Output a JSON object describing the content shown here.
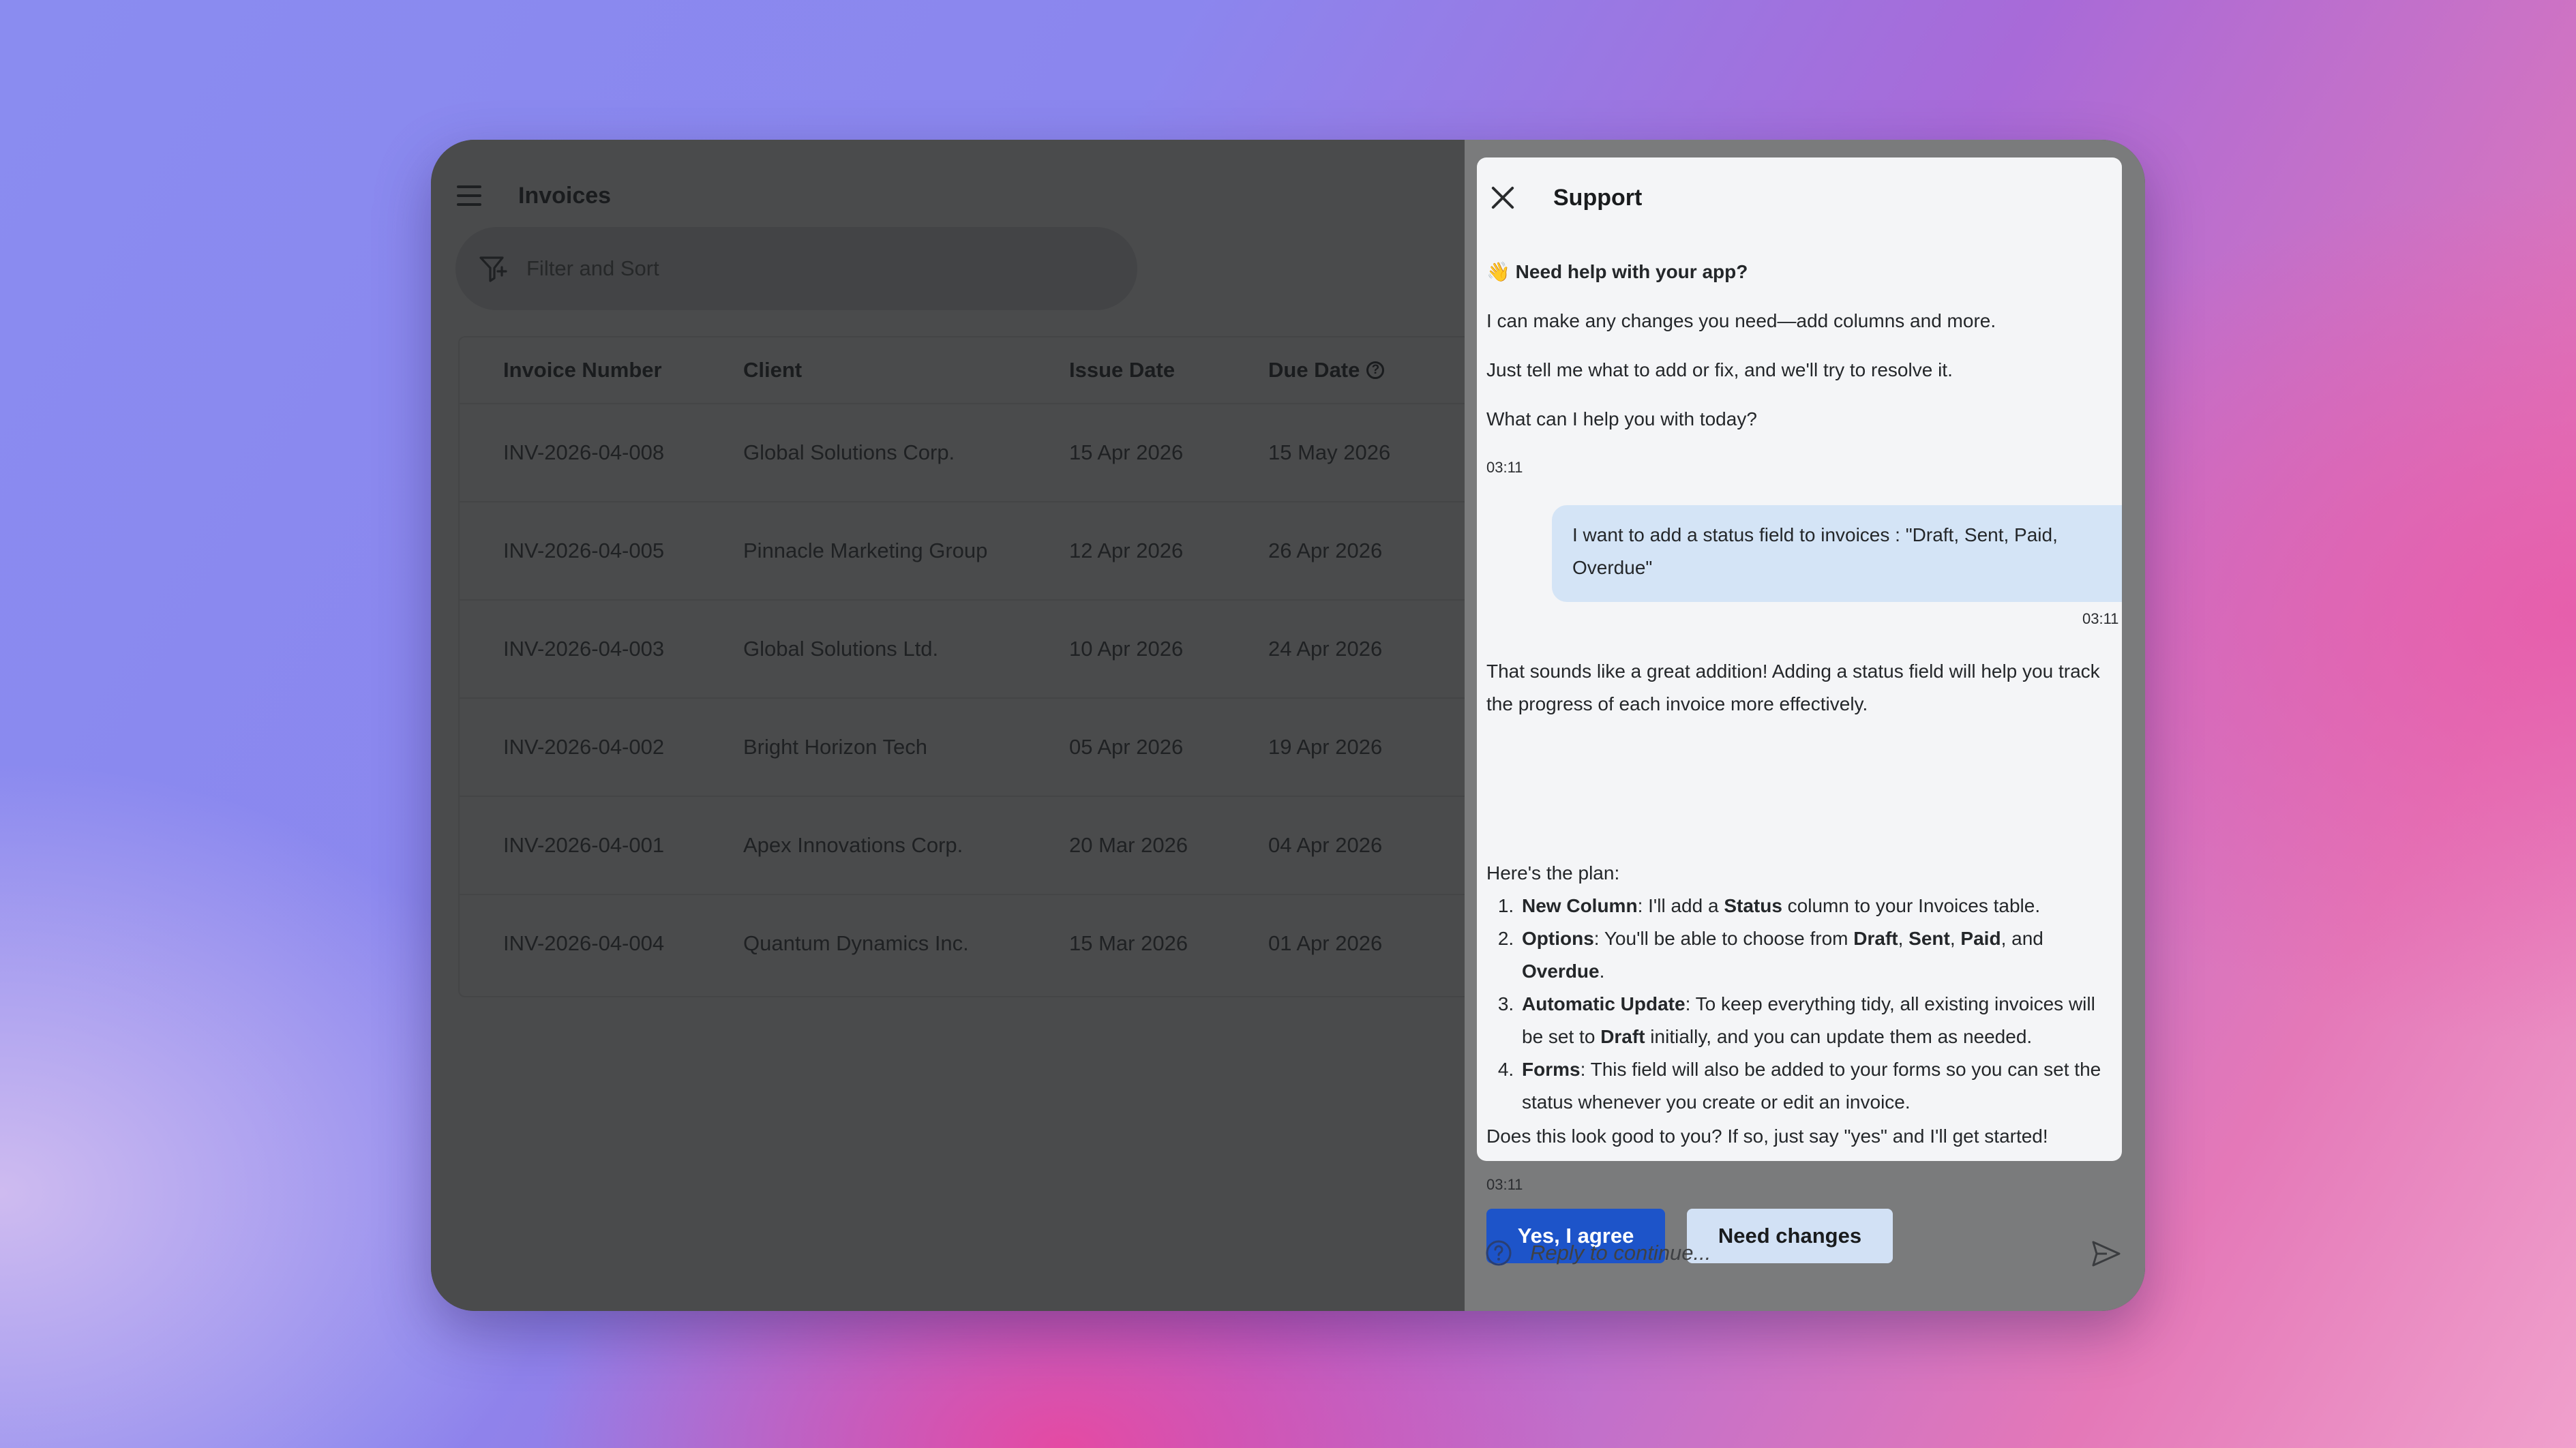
{
  "app": {
    "title": "Invoices",
    "filter_placeholder": "Filter and Sort",
    "columns": [
      "Invoice Number",
      "Client",
      "Issue Date",
      "Due Date"
    ],
    "rows": [
      [
        "INV-2026-04-008",
        "Global Solutions Corp.",
        "15 Apr 2026",
        "15 May 2026"
      ],
      [
        "INV-2026-04-005",
        "Pinnacle Marketing Group",
        "12 Apr 2026",
        "26 Apr 2026"
      ],
      [
        "INV-2026-04-003",
        "Global Solutions Ltd.",
        "10 Apr 2026",
        "24 Apr 2026"
      ],
      [
        "INV-2026-04-002",
        "Bright Horizon Tech",
        "05 Apr 2026",
        "19 Apr 2026"
      ],
      [
        "INV-2026-04-001",
        "Apex Innovations Corp.",
        "20 Mar 2026",
        "04 Apr 2026"
      ],
      [
        "INV-2026-04-004",
        "Quantum Dynamics Inc.",
        "15 Mar 2026",
        "01 Apr 2026"
      ]
    ]
  },
  "support": {
    "title": "Support",
    "greeting_emoji": "👋",
    "greeting": "Need help with your app?",
    "intro_1": "I can make any changes you need—add columns and more.",
    "intro_2": "Just tell me what to add or fix, and we'll try to resolve it.",
    "intro_3": "What can I help you with today?",
    "time_1": "03:11",
    "user_message": "I want to add a status field to invoices : \"Draft, Sent, Paid, Overdue\"",
    "time_2": "03:11",
    "reply_1": "That sounds like a great addition! Adding a status field will help you track the progress of each invoice more effectively.",
    "plan_intro": "Here's the plan:",
    "plan": [
      {
        "title": "New Column",
        "text_a": ": I'll add a ",
        "bold": "Status",
        "text_b": " column to your Invoices table."
      },
      {
        "title": "Options",
        "text_a": ": You'll be able to choose from ",
        "opt1": "Draft",
        "opt2": "Sent",
        "opt3": "Paid",
        "opt4": "Overdue"
      },
      {
        "title": "Automatic Update",
        "text_a": ": To keep everything tidy, all existing invoices will be set to ",
        "bold": "Draft",
        "text_b": " initially, and you can update them as needed."
      },
      {
        "title": "Forms",
        "text_a": ": This field will also be added to your forms so you can set the status whenever you create or edit an invoice."
      }
    ],
    "confirm_question": "Does this look good to you? If so, just say \"yes\" and I'll get started!",
    "time_3": "03:11",
    "yes_label": "Yes, I agree",
    "changes_label": "Need changes",
    "reply_placeholder": "Reply to continue..."
  }
}
